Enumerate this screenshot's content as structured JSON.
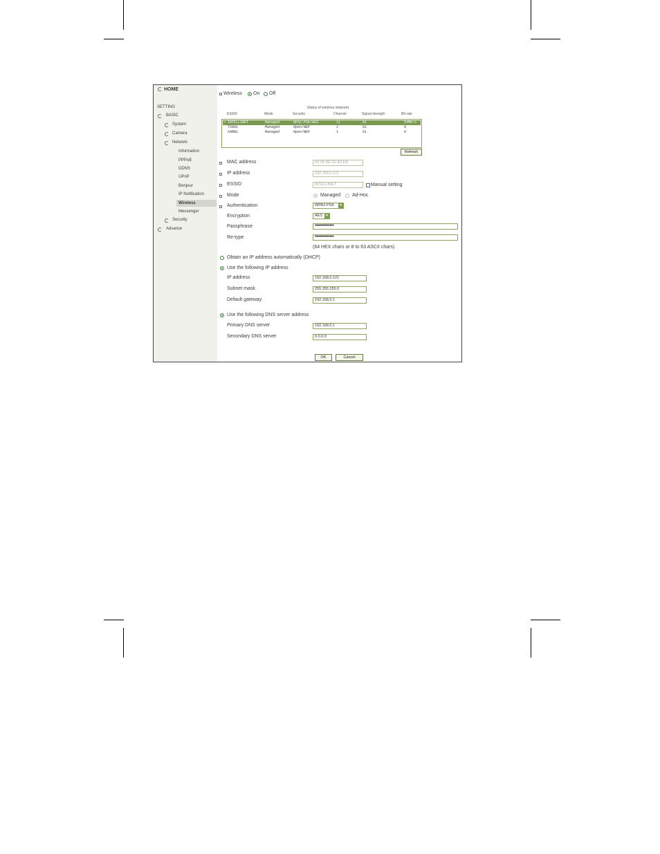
{
  "sidebar": {
    "home": "HOME",
    "setting": "SETTING",
    "items": [
      {
        "label": "BASIC"
      },
      {
        "label": "System"
      },
      {
        "label": "Camera"
      },
      {
        "label": "Network"
      },
      {
        "label": "Information"
      },
      {
        "label": "PPPoE"
      },
      {
        "label": "DDNS"
      },
      {
        "label": "UPnP"
      },
      {
        "label": "Bonjour"
      },
      {
        "label": "IP Notification"
      },
      {
        "label": "Wireless"
      },
      {
        "label": "Messenger"
      },
      {
        "label": "Security"
      },
      {
        "label": "Advance"
      }
    ],
    "selected": "Wireless"
  },
  "wireless": {
    "label": "Wireless",
    "on_label": "On",
    "off_label": "Off",
    "selected": "On"
  },
  "networks": {
    "title": "Status of wireless networks",
    "headers": [
      "ESSID",
      "Mode",
      "Security",
      "Channel",
      "Signal strength",
      "Bit rate"
    ],
    "rows": [
      [
        "> INTELLINET",
        "Managed",
        "WPA2-PSK/AES",
        "11",
        "81",
        "54Mb/s"
      ],
      [
        "TX801",
        "Managed",
        "Open/WEP",
        "1",
        "61",
        "0"
      ],
      [
        "XARB1",
        "Managed",
        "Open/WEP",
        "1",
        "61",
        "0"
      ]
    ],
    "refresh_label": "Refresh"
  },
  "form": {
    "mac_label": "MAC address",
    "mac_value": "00:0E:8E:1E:A2:EB",
    "ip_label": "IP address",
    "ip_value": "192.168.0.121",
    "essid_label": "ESSID",
    "essid_value": "INTELLINET",
    "manual_label": "Manual setting",
    "mode_label": "Mode",
    "mode_managed": "Managed",
    "mode_adhoc": "Ad-Hoc",
    "auth_label": "Authentication",
    "auth_value": "WPA2-PSK",
    "enc_label": "Encryption",
    "enc_value": "AES",
    "pass_label": "Passphrase",
    "pass_value": "••••••••••••••",
    "retype_label": "Re-type",
    "retype_value": "••••••••••••••",
    "hint": "(64 HEX chars or 8 to 63 ASCII chars)"
  },
  "ip": {
    "dhcp_label": "Obtain an IP address automatically (DHCP)",
    "static_label": "Use the following IP address",
    "ip_label": "IP address",
    "ip_value": "192.168.0.121",
    "mask_label": "Subnet mask",
    "mask_value": "255.255.255.0",
    "gw_label": "Default gateway",
    "gw_value": "192.168.0.1"
  },
  "dns": {
    "label": "Use the following DNS server address",
    "primary_label": "Primary DNS server",
    "primary_value": "192.168.0.1",
    "secondary_label": "Secondary DNS server",
    "secondary_value": "0.0.0.0"
  },
  "actions": {
    "ok": "OK",
    "cancel": "Cancel"
  }
}
